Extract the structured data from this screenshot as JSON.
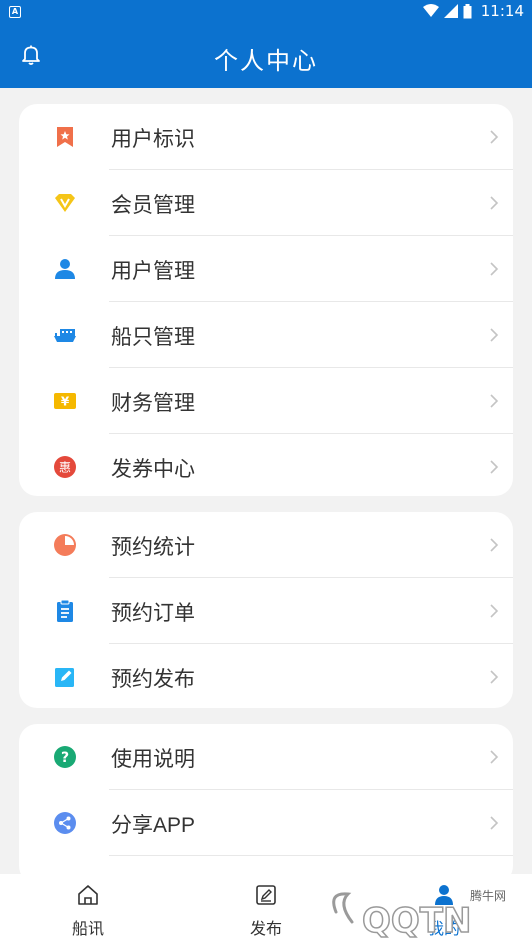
{
  "status_bar": {
    "time": "11:14"
  },
  "header": {
    "title": "个人中心"
  },
  "groups": [
    {
      "items": [
        {
          "label": "用户标识",
          "icon": "bookmark-star-icon",
          "color": "#f0704a"
        },
        {
          "label": "会员管理",
          "icon": "vip-diamond-icon",
          "color": "#f5c518"
        },
        {
          "label": "用户管理",
          "icon": "user-icon",
          "color": "#1e88e5"
        },
        {
          "label": "船只管理",
          "icon": "ship-icon",
          "color": "#1e88e5"
        },
        {
          "label": "财务管理",
          "icon": "yuan-card-icon",
          "color": "#f5b800"
        },
        {
          "label": "发券中心",
          "icon": "coupon-hui-icon",
          "color": "#e4493b"
        }
      ]
    },
    {
      "items": [
        {
          "label": "预约统计",
          "icon": "pie-chart-icon",
          "color": "#f47c5a"
        },
        {
          "label": "预约订单",
          "icon": "clipboard-icon",
          "color": "#1e88e5"
        },
        {
          "label": "预约发布",
          "icon": "edit-icon",
          "color": "#29b6f6"
        }
      ]
    },
    {
      "items": [
        {
          "label": "使用说明",
          "icon": "help-icon",
          "color": "#19a974"
        },
        {
          "label": "分享APP",
          "icon": "share-icon",
          "color": "#5b8def"
        }
      ]
    }
  ],
  "tabbar": {
    "tabs": [
      {
        "label": "船讯",
        "icon": "home-icon"
      },
      {
        "label": "发布",
        "icon": "publish-icon"
      },
      {
        "label": "我的",
        "icon": "profile-icon"
      }
    ]
  },
  "watermark": {
    "text": "腾牛网"
  },
  "colors": {
    "primary": "#0c72cf"
  }
}
